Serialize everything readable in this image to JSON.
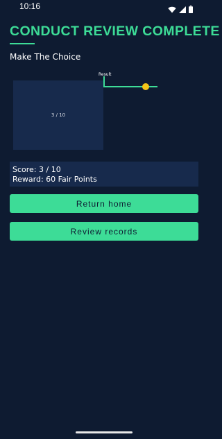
{
  "status_bar": {
    "time": "10:16"
  },
  "header": {
    "title": "CONDUCT REVIEW COMPLETE",
    "subtitle": "Make The Choice"
  },
  "progress": {
    "box_label": "3 / 10",
    "result_label": "Result"
  },
  "score": {
    "score_line": "Score: 3 / 10",
    "reward_line": "Reward: 60 Fair Points"
  },
  "buttons": {
    "return_home": "Return home",
    "review_records": "Review records"
  },
  "colors": {
    "background": "#0e1b31",
    "accent": "#3ddc97",
    "panel": "#172a4c",
    "knob": "#f5c518"
  }
}
